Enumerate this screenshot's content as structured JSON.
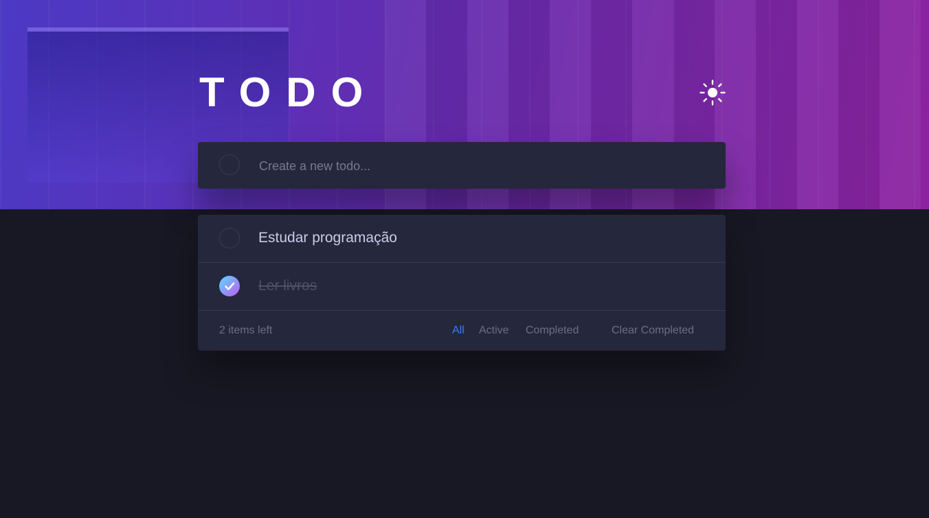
{
  "app": {
    "title": "TODO",
    "theme_toggle_icon": "sun-icon"
  },
  "new_todo": {
    "placeholder": "Create a new todo..."
  },
  "todos": [
    {
      "text": "Estudar programação",
      "completed": false
    },
    {
      "text": "Ler livros",
      "completed": true
    }
  ],
  "footer": {
    "items_left": "2 items left",
    "filters": {
      "all": "All",
      "active": "Active",
      "completed": "Completed"
    },
    "active_filter": "all",
    "clear_completed": "Clear Completed"
  },
  "colors": {
    "accent": "#3a7cfd",
    "card_bg": "#25273c",
    "page_bg": "#181824",
    "check_gradient": [
      "#57ddff",
      "#c058f3"
    ]
  }
}
